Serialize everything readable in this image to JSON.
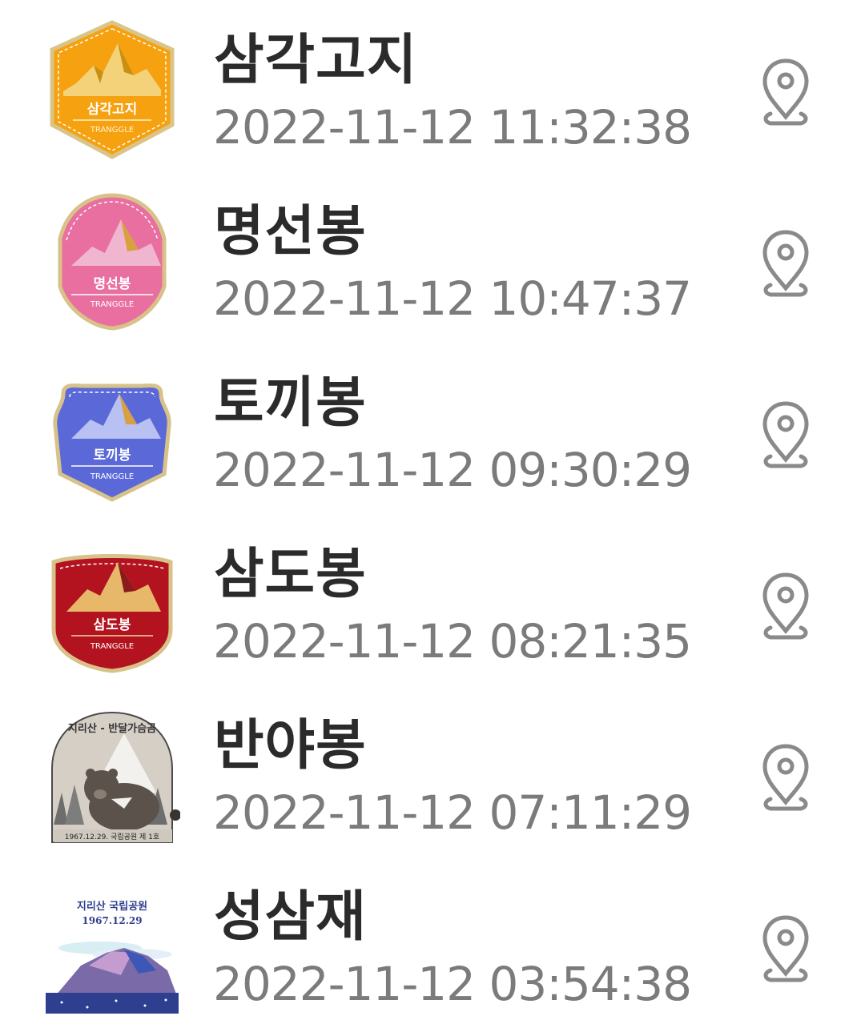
{
  "items": [
    {
      "name": "삼각고지",
      "time": "2022-11-12 11:32:38",
      "badge_text": "삼각고지",
      "badge_brand": "TRANGGLE",
      "badge_color": "#f6a10f",
      "badge_icon": "mountain-badge-icon"
    },
    {
      "name": "명선봉",
      "time": "2022-11-12 10:47:37",
      "badge_text": "명선봉",
      "badge_brand": "TRANGGLE",
      "badge_color": "#e86fa0",
      "badge_icon": "mountain-badge-icon"
    },
    {
      "name": "토끼봉",
      "time": "2022-11-12 09:30:29",
      "badge_text": "토끼봉",
      "badge_brand": "TRANGGLE",
      "badge_color": "#5a68d8",
      "badge_icon": "mountain-badge-icon"
    },
    {
      "name": "삼도봉",
      "time": "2022-11-12 08:21:35",
      "badge_text": "삼도봉",
      "badge_brand": "TRANGGLE",
      "badge_color": "#b3121f",
      "badge_icon": "mountain-badge-icon"
    },
    {
      "name": "반야봉",
      "time": "2022-11-12 07:11:29",
      "badge_text": "지리산 - 반달가슴곰",
      "badge_brand": "1967.12.29. 국립공원 제 1호",
      "badge_color": "#c9c2ba",
      "badge_icon": "bear-badge-icon"
    },
    {
      "name": "성삼재",
      "time": "2022-11-12 03:54:38",
      "badge_text": "지리산 국립공원",
      "badge_brand": "1967.12.29",
      "badge_color": "#2f3f8f",
      "badge_icon": "mountain-sky-badge-icon"
    }
  ],
  "pin_icon": "location-pin-icon",
  "colors": {
    "title": "#2b2b2b",
    "time": "#7b7b7b",
    "pin": "#8a8a8a"
  }
}
